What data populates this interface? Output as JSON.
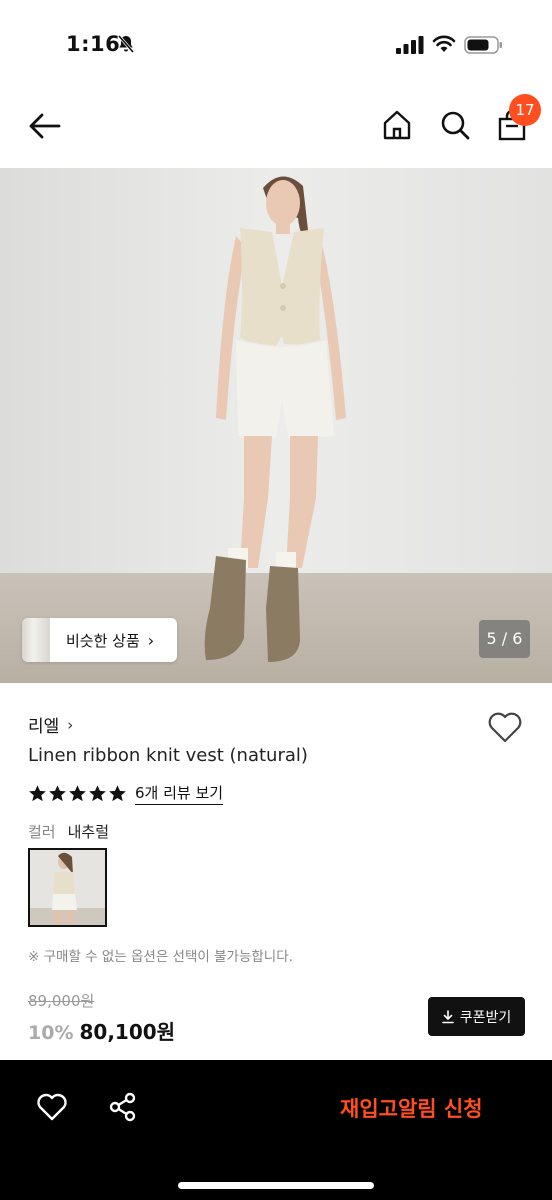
{
  "status_bar": {
    "time": "1:16",
    "icons": [
      "bell-slash-icon",
      "cellular-signal-icon",
      "wifi-icon",
      "battery-icon"
    ]
  },
  "nav": {
    "icons": [
      "back-arrow-icon",
      "home-icon",
      "search-icon",
      "shopping-bag-icon"
    ],
    "cart_count": "17"
  },
  "gallery": {
    "similar_button_label": "비슷한 상품",
    "counter": "5 / 6",
    "current_image": 5,
    "total_images": 6
  },
  "product": {
    "brand": "리엘",
    "title": "Linen ribbon knit vest (natural)",
    "rating_stars": 5,
    "review_link": "6개 리뷰 보기",
    "color_label": "컬러",
    "color_value": "내추럴",
    "notice": "※ 구매할 수 없는 옵션은 선택이 불가능합니다.",
    "original_price": "89,000원",
    "discount": "10%",
    "sale_price": "80,100원",
    "coupon_label": "쿠폰받기"
  },
  "bottom_bar": {
    "icons": [
      "heart-icon",
      "share-icon"
    ],
    "restock_label": "재입고알림 신청"
  },
  "colors": {
    "accent": "#ff4e1f",
    "bottom_bar_bg": "#000000",
    "text_primary": "#111111",
    "text_muted": "#888888"
  }
}
